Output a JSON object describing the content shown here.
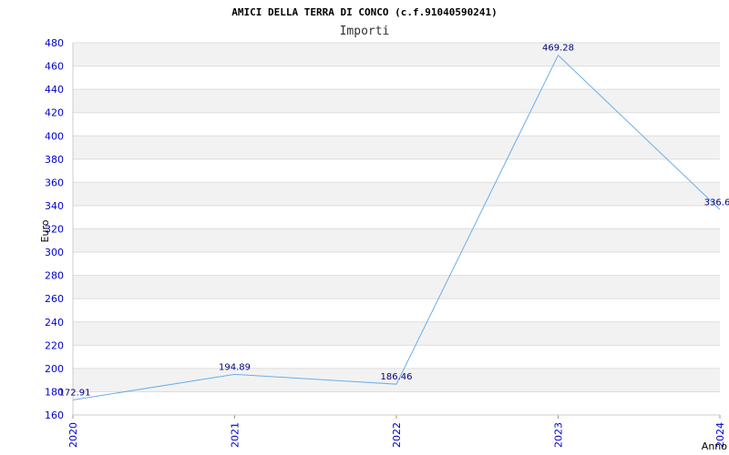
{
  "chart_data": {
    "type": "line",
    "title": "AMICI DELLA TERRA DI CONCO (c.f.91040590241)",
    "subtitle": "Importi",
    "xlabel": "Anno",
    "ylabel": "Euro",
    "categories": [
      "2020",
      "2021",
      "2022",
      "2023",
      "2024"
    ],
    "series": [
      {
        "values": [
          172.91,
          194.89,
          186.46,
          469.28,
          336.6
        ]
      }
    ],
    "data_labels": [
      "172.91",
      "194.89",
      "186.46",
      "469.28",
      "336.6"
    ],
    "ylim": [
      160,
      480
    ],
    "yticks": [
      160,
      180,
      200,
      220,
      240,
      260,
      280,
      300,
      320,
      340,
      360,
      380,
      400,
      420,
      440,
      460,
      480
    ],
    "grid": true,
    "colors": {
      "line": "#6aaee8",
      "band": "#f2f2f2",
      "grid": "#dddddd",
      "tick": "#0000cc",
      "label": "#000080"
    }
  }
}
